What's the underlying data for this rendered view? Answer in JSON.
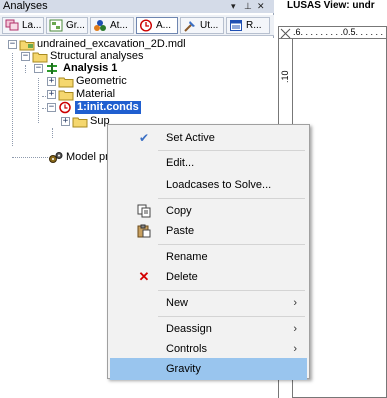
{
  "panel": {
    "title": "Analyses",
    "controls": {
      "pin": "▾",
      "dock": "⊥",
      "close": "✕"
    },
    "tabs": [
      {
        "label": "La...",
        "icon": "layers-icon"
      },
      {
        "label": "Gr...",
        "icon": "groups-icon"
      },
      {
        "label": "At...",
        "icon": "attributes-icon"
      },
      {
        "label": "A...",
        "icon": "analyses-icon"
      },
      {
        "label": "Ut...",
        "icon": "utilities-icon"
      },
      {
        "label": "R...",
        "icon": "reports-icon"
      }
    ]
  },
  "tree": {
    "root": "undrained_excavation_2D.mdl",
    "structural": "Structural analyses",
    "analysis": "Analysis 1",
    "geometric": "Geometric",
    "material": "Material",
    "loadcase": "1:init.conds",
    "supports": "Sup",
    "model_properties": "Model properte"
  },
  "view": {
    "title": "LUSAS View: undr",
    "ruler_top": ".6. . . . . . . . .0.5. . . . . .",
    "ruler_left": ".10"
  },
  "context_menu": {
    "items": [
      {
        "label": "Set Active",
        "icon": "checkmark-icon",
        "glyph": "✔",
        "color": "#3a6fc4"
      },
      {
        "label": "Edit..."
      },
      {
        "label": "Loadcases to Solve..."
      },
      {
        "label": "Copy",
        "icon": "copy-icon"
      },
      {
        "label": "Paste",
        "icon": "paste-icon"
      },
      {
        "label": "Rename"
      },
      {
        "label": "Delete",
        "icon": "delete-x-icon",
        "glyph": "✕",
        "color": "#d40000"
      },
      {
        "label": "New",
        "submenu": "›"
      },
      {
        "label": "Deassign",
        "submenu": "›"
      },
      {
        "label": "Controls",
        "submenu": "›"
      },
      {
        "label": "Gravity",
        "highlighted": true
      }
    ]
  }
}
